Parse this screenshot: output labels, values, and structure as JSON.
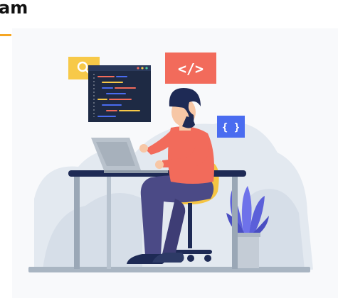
{
  "section": {
    "heading": "am"
  },
  "illustration": {
    "code_tag": "</>",
    "braces_tag": "{ }",
    "colors": {
      "accent": "#f5a623",
      "code_tag_bg": "#f26b5b",
      "braces_tag_bg": "#4a6cf0",
      "search_tag_bg": "#f7c948",
      "editor_bg": "#1e2a44",
      "shirt": "#f26b5b",
      "pants": "#4b4a86",
      "hair": "#1e2a55",
      "skin": "#f7c7a6",
      "desk": "#1e2a55",
      "laptop": "#b9c2cc",
      "plant": "#5b5fd9",
      "pot": "#c4ccd6",
      "background_blob": "#e3e9f0",
      "floor": "#a9b5c2"
    },
    "icons": [
      "search-icon",
      "code-tag-icon",
      "braces-icon",
      "code-editor-icon",
      "laptop-icon",
      "chair-icon",
      "plant-icon"
    ]
  }
}
